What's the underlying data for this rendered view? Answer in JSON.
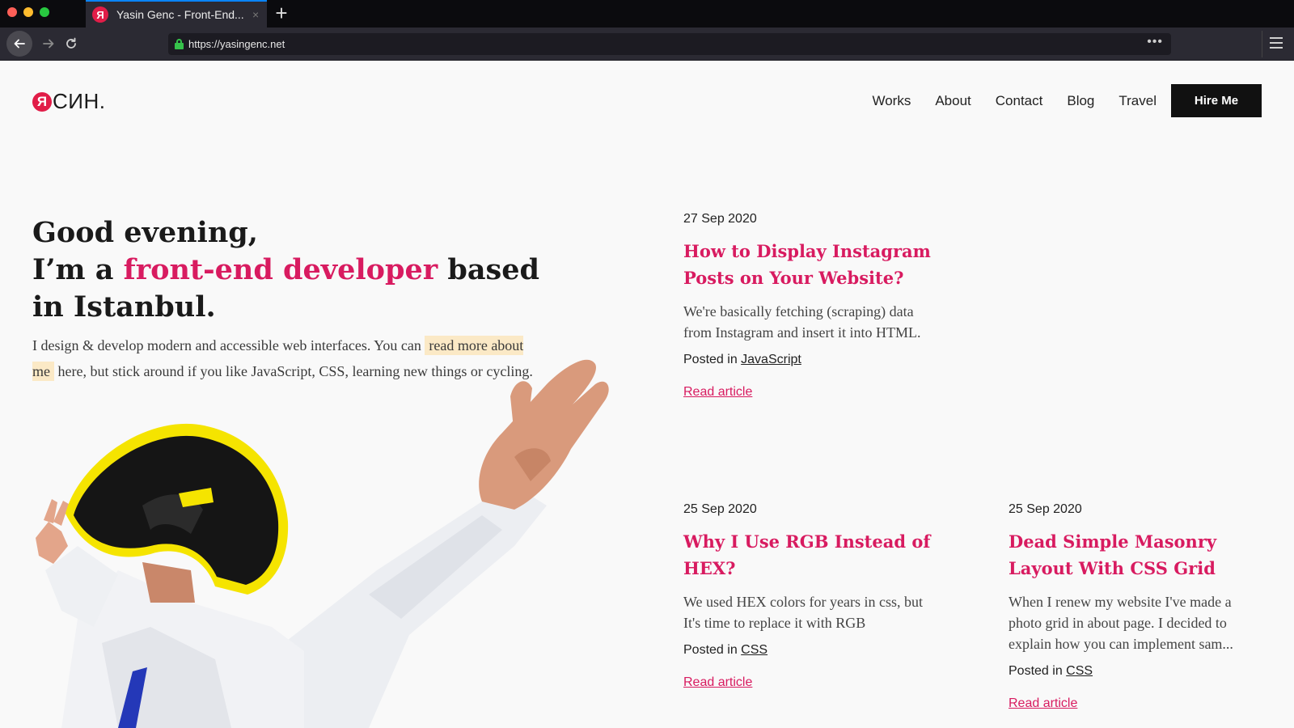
{
  "browser": {
    "tab_title": "Yasin Genc - Front-End...",
    "tab_favicon": "Я",
    "tab_close": "×",
    "new_tab": "+",
    "url": "https://yasingenc.net",
    "url_more": "•••"
  },
  "header": {
    "logo_badge": "Я",
    "logo_text": "СИН.",
    "nav": [
      "Works",
      "About",
      "Contact",
      "Blog",
      "Travel"
    ],
    "hire_label": "Hire Me"
  },
  "hero": {
    "line1": "Good evening,",
    "line2_pre": "I’m a ",
    "line2_accent": "front-end developer",
    "line2_post": " based",
    "line3": "in Istanbul.",
    "intro_pre": "I design & develop modern and accessible web interfaces. You can ",
    "intro_link": "read more about me",
    "intro_post": " here, but stick around if you like JavaScript, CSS, learning new things or cycling."
  },
  "articles": [
    {
      "date": "27 Sep 2020",
      "title": "How to Display Instagram Posts on Your Website?",
      "excerpt": "We're basically fetching (scraping) data from Instagram and insert it into HTML.",
      "posted_prefix": "Posted in ",
      "category": "JavaScript",
      "read_label": "Read article"
    },
    {
      "date": "25 Sep 2020",
      "title": "Why I Use RGB Instead of HEX?",
      "excerpt": "We used HEX colors for years in css, but It's time to replace it with RGB",
      "posted_prefix": "Posted in ",
      "category": "CSS",
      "read_label": "Read article"
    },
    {
      "date": "25 Sep 2020",
      "title": "Dead Simple Masonry Layout With CSS Grid",
      "excerpt": "When I renew my website I've made a photo grid in about page. I decided to explain how you can implement sam...",
      "posted_prefix": "Posted in ",
      "category": "CSS",
      "read_label": "Read article"
    }
  ],
  "colors": {
    "accent": "#d81b60",
    "highlight": "#fbe9c6",
    "button_bg": "#111111",
    "helmet_trim": "#f5e400"
  },
  "icons": [
    "back-arrow-icon",
    "forward-arrow-icon",
    "reload-icon",
    "lock-icon",
    "more-icon",
    "hamburger-menu-icon"
  ]
}
